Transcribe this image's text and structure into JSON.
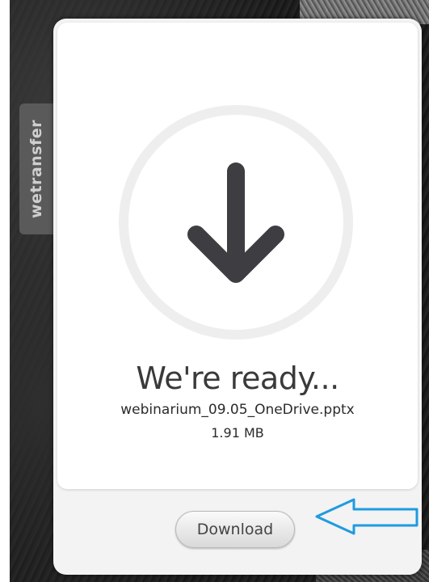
{
  "side_tab": {
    "label": "wetransfer"
  },
  "panel": {
    "title": "We're ready...",
    "file_name": "webinarium_09.05_OneDrive.pptx",
    "file_size": "1.91 MB",
    "download_label": "Download"
  },
  "icons": {
    "main": "download-arrow-icon",
    "annotation": "outline-arrow-left-icon"
  },
  "colors": {
    "panel_bg": "#f3f3f3",
    "card_bg": "#ffffff",
    "ring": "#eeeeee",
    "arrow": "#3d3d42",
    "title_text": "#3a3a3a",
    "button_text": "#444444",
    "side_tab_bg": "#5a5a5a",
    "annotation_arrow": "#1e9be0"
  }
}
